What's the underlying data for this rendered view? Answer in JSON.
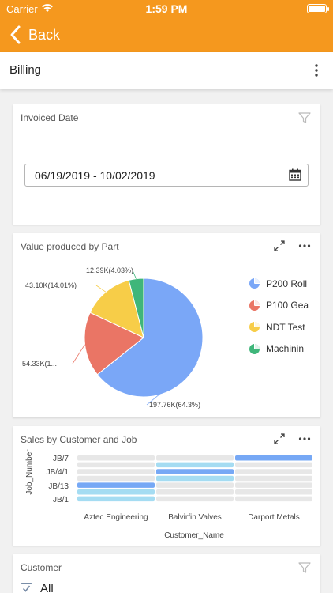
{
  "status_bar": {
    "carrier": "Carrier",
    "time": "1:59 PM"
  },
  "nav": {
    "back_label": "Back"
  },
  "page": {
    "title": "Billing"
  },
  "invoiced_date": {
    "title": "Invoiced Date",
    "value": "06/19/2019 - 10/02/2019"
  },
  "value_by_part": {
    "title": "Value produced by Part",
    "legend": [
      "P200 Roll",
      "P100 Gea",
      "NDT Test",
      "Machinin"
    ]
  },
  "sales_by_customer": {
    "title": "Sales by Customer and Job"
  },
  "customer_filter": {
    "title": "Customer",
    "all_label": "All"
  },
  "colors": {
    "accent": "#f5981e",
    "pie": [
      "#7aa7f7",
      "#ea7565",
      "#f7cd48",
      "#3fb67a"
    ],
    "heat_light": "#a5dcf2",
    "heat_dark": "#76a8f5",
    "heat_empty": "#e7e7e7"
  },
  "chart_data": [
    {
      "type": "pie",
      "title": "Value produced by Part",
      "slices": [
        {
          "name": "P200 Roll",
          "value": 197.76,
          "label": "197.76K(64.3%)",
          "percent": 64.3
        },
        {
          "name": "P100 Gea",
          "value": 54.33,
          "label": "54.33K(1...",
          "percent": 17.66
        },
        {
          "name": "NDT Test",
          "value": 43.1,
          "label": "43.10K(14.01%)",
          "percent": 14.01
        },
        {
          "name": "Machinin",
          "value": 12.39,
          "label": "12.39K(4.03%)",
          "percent": 4.03
        }
      ]
    },
    {
      "type": "heatmap",
      "title": "Sales by Customer and Job",
      "xlabel": "Customer_Name",
      "ylabel": "Job_Number",
      "x_categories": [
        "Aztec Engineering",
        "Balvirfin Valves",
        "Darport Metals"
      ],
      "y_categories": [
        "JB/7",
        "JB/4/1",
        "JB/13",
        "JB/1"
      ],
      "cells": [
        {
          "x": "Darport Metals",
          "y": "JB/7",
          "level": "dark"
        },
        {
          "x": "Balvirfin Valves",
          "y": "JB/4/1",
          "level": "light"
        },
        {
          "x": "Balvirfin Valves",
          "y": "JB/4/1",
          "level": "dark"
        },
        {
          "x": "Balvirfin Valves",
          "y": "JB/4/1",
          "level": "light"
        },
        {
          "x": "Aztec Engineering",
          "y": "JB/13",
          "level": "dark"
        },
        {
          "x": "Aztec Engineering",
          "y": "JB/1",
          "level": "light"
        },
        {
          "x": "Aztec Engineering",
          "y": "JB/1",
          "level": "light"
        }
      ]
    }
  ]
}
